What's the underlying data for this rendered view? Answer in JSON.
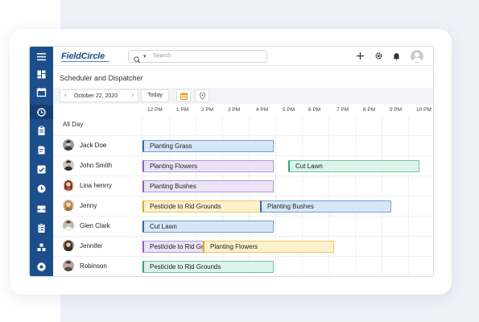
{
  "app": {
    "brand": "FieldCircle",
    "page_title": "Scheduler and Dispatcher",
    "accent_color": "#1c4e8c"
  },
  "sidebar": {
    "items": [
      {
        "icon": "menu-icon"
      },
      {
        "icon": "dashboard-icon"
      },
      {
        "icon": "calendar-icon"
      },
      {
        "icon": "dispatch-icon",
        "active": true
      },
      {
        "icon": "clipboard-icon"
      },
      {
        "icon": "invoice-icon"
      },
      {
        "icon": "checklist-icon"
      },
      {
        "icon": "clock-icon"
      },
      {
        "icon": "inbox-icon"
      },
      {
        "icon": "tasks-icon"
      },
      {
        "icon": "inventory-icon"
      },
      {
        "icon": "settings-icon"
      }
    ]
  },
  "topbar": {
    "search_placeholder": "Search",
    "icons": [
      "add-icon",
      "gear-icon",
      "bell-icon",
      "user-avatar-icon"
    ]
  },
  "toolbar": {
    "date": "October 22, 2020",
    "today_label": "Today",
    "icons": [
      "calendar-grid-icon",
      "map-pin-icon"
    ]
  },
  "timeline": {
    "ticks": [
      "12 PM",
      "1 PM",
      "2 PM",
      "3 PM",
      "4 PM",
      "5 PM",
      "6 PM",
      "7 PM",
      "8 PM",
      "9 PM",
      "10 PM"
    ]
  },
  "schedule": {
    "all_day_label": "All Day",
    "rows": [
      {
        "name": "Jack Doe",
        "events": [
          {
            "title": "Planting Grass",
            "color": "blue"
          }
        ]
      },
      {
        "name": "John Smith",
        "events": [
          {
            "title": "Planting Flowers",
            "color": "purple"
          },
          {
            "title": "Cut Lawn",
            "color": "green"
          }
        ]
      },
      {
        "name": "Lina henrry",
        "events": [
          {
            "title": "Planting Bushes",
            "color": "purple"
          }
        ]
      },
      {
        "name": "Jenny",
        "events": [
          {
            "title": "Pesticide to Rid Grounds",
            "color": "yellow"
          },
          {
            "title": "Planting Bushes",
            "color": "blue"
          }
        ]
      },
      {
        "name": "Glen Clark",
        "events": [
          {
            "title": "Cut Lawn",
            "color": "blue"
          }
        ]
      },
      {
        "name": "Jennifer",
        "events": [
          {
            "title": "Pesticide to Rid Grounds",
            "color": "purple"
          },
          {
            "title": "Planting Flowers",
            "color": "yellow"
          }
        ]
      },
      {
        "name": "Robinson",
        "events": [
          {
            "title": "Pesticide to Rid Grounds",
            "color": "green"
          }
        ]
      }
    ]
  }
}
